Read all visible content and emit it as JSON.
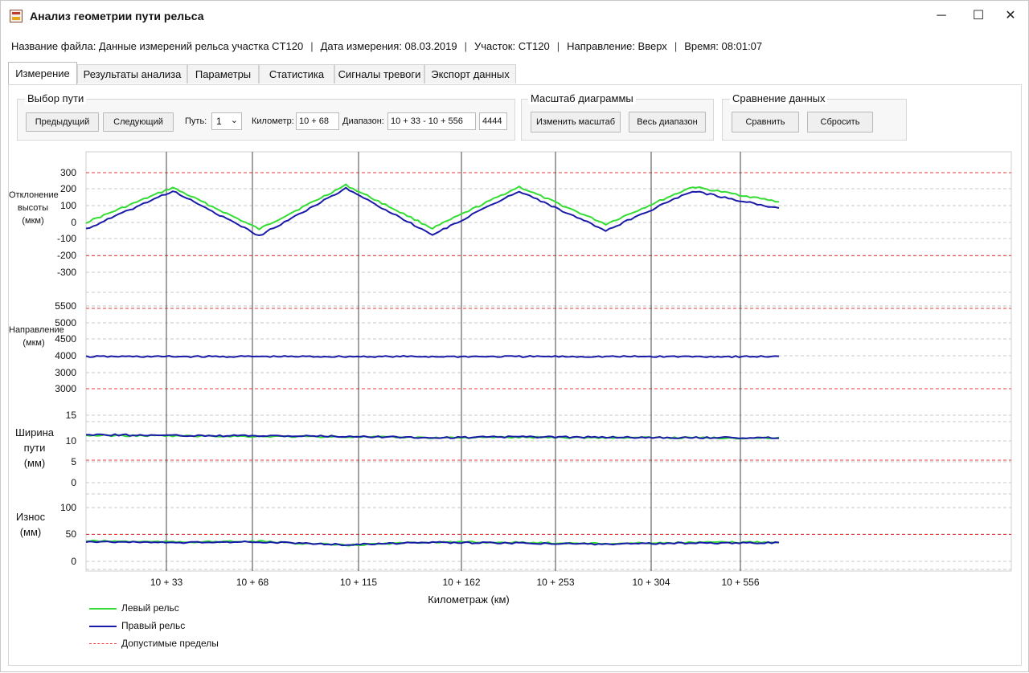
{
  "window": {
    "title": "Анализ геометрии пути рельса",
    "controls": {
      "minimize": "─",
      "maximize": "☐",
      "close": "✕"
    }
  },
  "info": {
    "file": "Название файла: Данные измерений рельса участка CT120",
    "date": "Дата измерения: 08.03.2019",
    "section": "Участок: CT120",
    "direction": "Направление: Вверх",
    "time": "Время: 08:01:07",
    "separator": "|"
  },
  "tabs": [
    "Измерение",
    "Результаты анализа",
    "Параметры",
    "Статистика",
    "Сигналы тревоги",
    "Экспорт данных"
  ],
  "path_group": {
    "title": "Выбор пути",
    "prev_label": "Предыдущий",
    "next_label": "Следующий",
    "path_label": "Путь:",
    "path_value": "1",
    "km_label": "Километр:",
    "km_value": "10 + 68",
    "range_label": "Диапазон:",
    "range_value": "10 + 33  - 10 + 556",
    "range_count": "4444"
  },
  "scale_group": {
    "title": "Масштаб диаграммы",
    "change_label": "Изменить масштаб",
    "full_label": "Весь диапазон"
  },
  "compare_group": {
    "title": "Сравнение данных",
    "compare_label": "Сравнить",
    "reset_label": "Сбросить"
  },
  "panels": {
    "height": {
      "label": "Отклонение высоты (мкм)",
      "ticks": [
        "300",
        "200",
        "100",
        "0",
        "-100",
        "-200",
        "-300"
      ]
    },
    "direction": {
      "label": "Направление (мкм)",
      "ticks": [
        "5500",
        "5000",
        "4500",
        "4000",
        "3000",
        "3000"
      ]
    },
    "gauge": {
      "label": "Ширина пути (мм)",
      "ticks": [
        "15",
        "10",
        "5",
        "0"
      ]
    },
    "wear": {
      "label": "Износ (мм)",
      "ticks": [
        "100",
        "50",
        "0"
      ]
    }
  },
  "colors": {
    "left_rail": "#33dd33",
    "right_rail": "#1a1aa8",
    "limit": "#e8393b"
  },
  "chart_data": {
    "type": "line",
    "xlabel": "Километраж (км)",
    "x_ticks": [
      "10 + 33",
      "10 + 68",
      "10 + 115",
      "10 + 162",
      "10 + 253",
      "10 + 304",
      "10 + 556"
    ],
    "legend": [
      "Левый рельс",
      "Правый рельс",
      "Допустимые пределы"
    ],
    "panels": [
      {
        "id": "height",
        "y_range": [
          -300,
          300
        ],
        "limits": [
          300,
          -200
        ],
        "series": [
          {
            "name": "Левый рельс",
            "values": [
              0,
              210,
              -40,
              225,
              -35,
              215,
              -10,
              215,
              125
            ]
          },
          {
            "name": "Правый рельс",
            "values": [
              -40,
              190,
              -80,
              205,
              -75,
              190,
              -50,
              190,
              85
            ]
          }
        ]
      },
      {
        "id": "direction",
        "y_range": [
          3000,
          5500
        ],
        "limits": [
          5500,
          3000
        ],
        "series": [
          {
            "name": "Правый рельс",
            "values": [
              4000,
              4000,
              4000,
              4000,
              4000,
              4000,
              4000,
              4000,
              4000
            ]
          }
        ]
      },
      {
        "id": "gauge",
        "y_range": [
          0,
          15
        ],
        "limits": [
          5
        ],
        "series": [
          {
            "name": "Левый рельс",
            "values": [
              10.5,
              10.4,
              10.3,
              10.2,
              10.0,
              10.1,
              10.0,
              10.0,
              9.9
            ]
          },
          {
            "name": "Правый рельс",
            "values": [
              10.7,
              10.5,
              10.4,
              10.3,
              10.0,
              10.2,
              10.1,
              10.0,
              10.0
            ]
          }
        ]
      },
      {
        "id": "wear",
        "y_range": [
          0,
          100
        ],
        "limits": [
          50
        ],
        "series": [
          {
            "name": "Левый рельс",
            "values": [
              38,
              36,
              37,
              30,
              36,
              35,
              33,
              35,
              36
            ]
          },
          {
            "name": "Правый рельс",
            "values": [
              37,
              35,
              36,
              31,
              35,
              34,
              32,
              34,
              35
            ]
          }
        ]
      }
    ]
  }
}
